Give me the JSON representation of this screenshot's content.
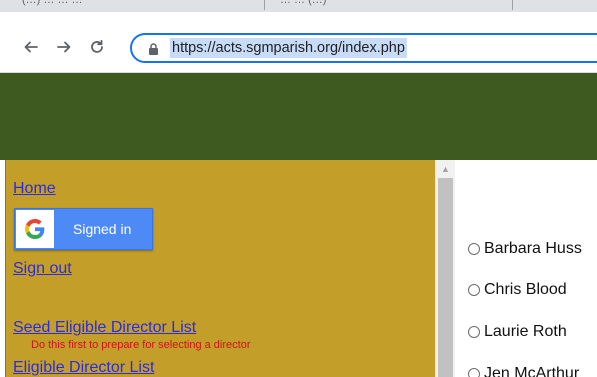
{
  "browser": {
    "tabs": [
      {
        "label": "(…) … … …"
      },
      {
        "label": "… … (…)"
      }
    ],
    "url": "https://acts.sgmparish.org/index.php",
    "nav_icons": [
      "back-arrow-icon",
      "forward-arrow-icon",
      "reload-icon",
      "lock-icon"
    ]
  },
  "colors": {
    "header_band": "#3f5a21",
    "nav_panel": "#c39f2a",
    "link": "#2b2be0",
    "hint": "#d0101a",
    "google_button": "#4d8af5",
    "omnibox_border": "#1a73e8"
  },
  "nav": {
    "home": "Home",
    "signin_label": "Signed in",
    "sign_out": "Sign out",
    "seed_list": "Seed Eligible Director List",
    "seed_hint": "Do this first to prepare for selecting a director",
    "eligible_list": "Eligible Director List"
  },
  "candidates": [
    {
      "name": "Barbara Huss"
    },
    {
      "name": "Chris Blood"
    },
    {
      "name": "Laurie Roth"
    },
    {
      "name": "Jen McArthur"
    }
  ]
}
